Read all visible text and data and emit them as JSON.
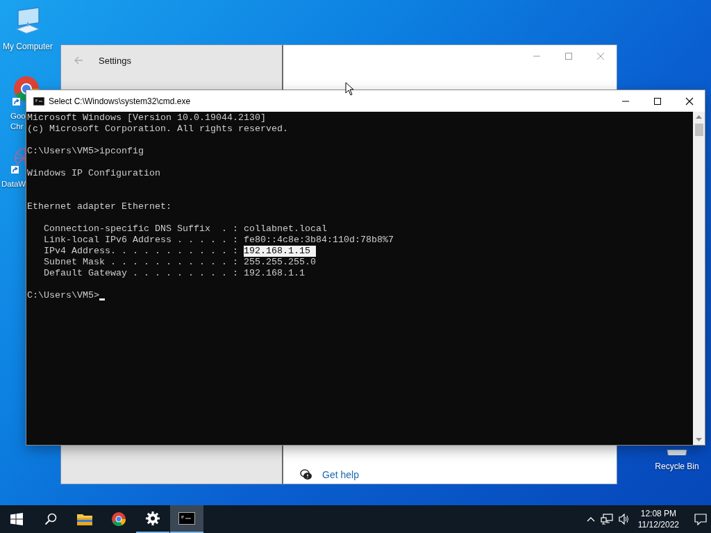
{
  "desktop": {
    "icons": [
      {
        "kind": "computer",
        "label_lines": [
          "My Computer"
        ],
        "shortcut": false
      },
      {
        "kind": "browser",
        "label_lines": [
          "Goo",
          "Chr"
        ],
        "shortcut": true
      },
      {
        "kind": "app",
        "label_lines": [
          "DataW"
        ],
        "shortcut": true
      },
      {
        "kind": "recycle",
        "label_lines": [
          "Recycle Bin"
        ],
        "shortcut": false
      }
    ]
  },
  "settings_window": {
    "title": "Settings",
    "help_link": "Get help"
  },
  "cmd_window": {
    "title": "Select C:\\Windows\\system32\\cmd.exe",
    "lines": [
      {
        "kind": "text",
        "text": "Microsoft Windows [Version 10.0.19044.2130]"
      },
      {
        "kind": "text",
        "text": "(c) Microsoft Corporation. All rights reserved."
      },
      {
        "kind": "blank"
      },
      {
        "kind": "text",
        "text": "C:\\Users\\VM5>ipconfig"
      },
      {
        "kind": "blank"
      },
      {
        "kind": "text",
        "text": "Windows IP Configuration"
      },
      {
        "kind": "blank"
      },
      {
        "kind": "blank"
      },
      {
        "kind": "text",
        "text": "Ethernet adapter Ethernet:"
      },
      {
        "kind": "blank"
      },
      {
        "kind": "text",
        "text": "   Connection-specific DNS Suffix  . : collabnet.local"
      },
      {
        "kind": "text",
        "text": "   Link-local IPv6 Address . . . . . : fe80::4c8e:3b84:110d:78b8%7"
      },
      {
        "kind": "text",
        "text": "   IPv4 Address. . . . . . . . . . . : ",
        "selection": "192.168.1.15 "
      },
      {
        "kind": "text",
        "text": "   Subnet Mask . . . . . . . . . . . : 255.255.255.0"
      },
      {
        "kind": "text",
        "text": "   Default Gateway . . . . . . . . . : 192.168.1.1"
      },
      {
        "kind": "blank"
      },
      {
        "kind": "prompt",
        "text": "C:\\Users\\VM5>"
      }
    ]
  },
  "taskbar": {
    "apps": [
      {
        "kind": "start",
        "running": false,
        "selected": false
      },
      {
        "kind": "search",
        "running": false,
        "selected": false
      },
      {
        "kind": "explorer",
        "running": false,
        "selected": false
      },
      {
        "kind": "chrome",
        "running": false,
        "selected": false
      },
      {
        "kind": "settings",
        "running": true,
        "selected": false
      },
      {
        "kind": "cmd",
        "running": true,
        "selected": true
      }
    ],
    "clock": {
      "time": "12:08 PM",
      "date": "11/12/2022"
    }
  }
}
